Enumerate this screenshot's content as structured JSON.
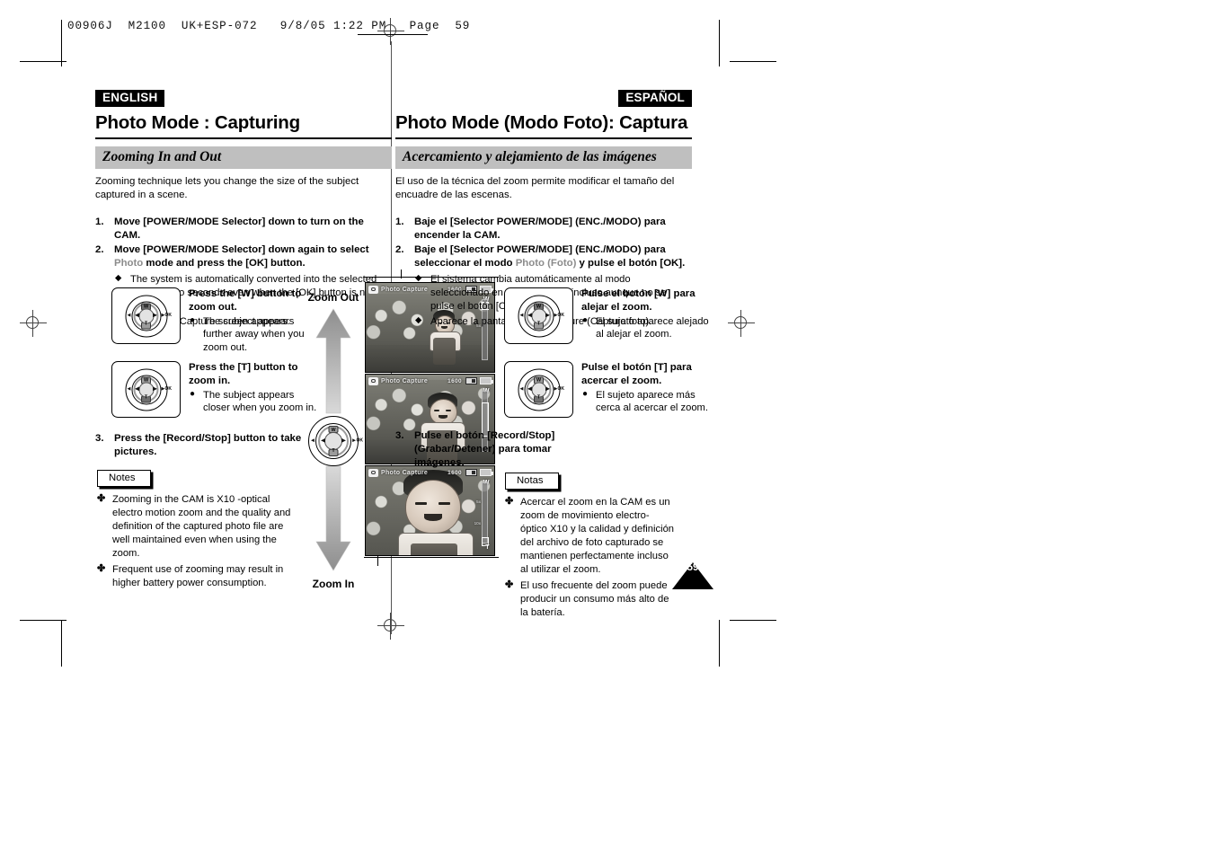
{
  "printer_header": "00906J  M2100  UK+ESP-072   9/8/05 1:22 PM   Page  59",
  "page_number": "59",
  "english": {
    "lang_tag": "ENGLISH",
    "title": "Photo Mode : Capturing",
    "section": "Zooming In and Out",
    "intro": "Zooming technique lets you change the size of the subject captured in a scene.",
    "steps": [
      {
        "num": "1.",
        "text": "Move [POWER/MODE Selector] down to turn on the CAM.",
        "bullets": []
      },
      {
        "num": "2.",
        "text_a": "Move [POWER/MODE Selector] down again to select ",
        "term": "Photo",
        "text_b": " mode and press the [OK] button.",
        "bullets": [
          "The system is automatically converted into the selected mode in two seconds even when the [OK] button is not pressed.",
          "The Photo Capture screen appears."
        ]
      }
    ],
    "dial_w": {
      "heading": "Press the [W] button to zoom out.",
      "bullet": "The subject appears further away when you zoom out."
    },
    "dial_t": {
      "heading": "Press the [T] button to zoom in.",
      "bullet": "The subject appears closer when you zoom in."
    },
    "step3": {
      "num": "3.",
      "text": "Press the [Record/Stop] button to take pictures."
    },
    "notes_label": "Notes",
    "notes": [
      "Zooming in the CAM is X10 -optical electro motion zoom and the quality and definition of the captured photo file are well maintained even when using the zoom.",
      "Frequent use of zooming may result in higher battery power consumption."
    ]
  },
  "spanish": {
    "lang_tag": "ESPAÑOL",
    "title": "Photo Mode (Modo Foto): Captura",
    "section": "Acercamiento y alejamiento de las imágenes",
    "intro": "El uso de la técnica del zoom permite modificar el tamaño del encuadre de las escenas.",
    "steps": [
      {
        "num": "1.",
        "text": "Baje el [Selector POWER/MODE] (ENC./MODO) para encender la CAM.",
        "bullets": []
      },
      {
        "num": "2.",
        "text_a": "Baje el [Selector POWER/MODE] (ENC./MODO) para seleccionar el modo ",
        "term": "Photo (Foto)",
        "text_b": " y pulse el botón [OK].",
        "bullets": [
          "El sistema cambia automáticamente al modo seleccionado en dos segundos incluso aunque no se pulse el botón [OK].",
          "Aparece la pantalla Photo Capture (Captura foto)."
        ]
      }
    ],
    "dial_w": {
      "heading": "Pulse el botón [W] para alejar el zoom.",
      "bullet": "El sujeto aparece alejado al alejar el zoom."
    },
    "dial_t": {
      "heading": "Pulse el botón [T] para acercar el zoom.",
      "bullet": "El sujeto aparece más cerca al acercar el zoom."
    },
    "step3": {
      "num": "3.",
      "text": "Pulse el botón [Record/Stop] (Grabar/Detener) para tomar imágenes."
    },
    "notes_label": "Notas",
    "notes": [
      "Acercar el zoom en la CAM es un zoom de movimiento electro-óptico X10 y la calidad y definición del archivo de foto capturado se mantienen perfectamente incluso al utilizar el zoom.",
      "El uso frecuente del zoom puede producir un consumo más alto de la batería."
    ]
  },
  "zoom_column": {
    "out_label": "Zoom Out",
    "in_label": "Zoom In"
  },
  "dial": {
    "w_label": "W",
    "t_label": "T",
    "ok_label": "OK",
    "left_arrow": "◀",
    "right_arrow": "▶",
    "far_left_arrow": "◀",
    "far_right_arrow": "▶"
  },
  "lcd_screens": [
    {
      "osd_title": "Photo Capture",
      "resolution": "1600",
      "zoom_w": "W",
      "zoom_t": "T",
      "zoom_state": "wide"
    },
    {
      "osd_title": "Photo Capture",
      "resolution": "1600",
      "zoom_w": "W",
      "zoom_t": "T",
      "zoom_state": "mid"
    },
    {
      "osd_title": "Photo Capture",
      "resolution": "1600",
      "zoom_w": "W",
      "zoom_t": "T",
      "zoom_state": "tele"
    }
  ]
}
